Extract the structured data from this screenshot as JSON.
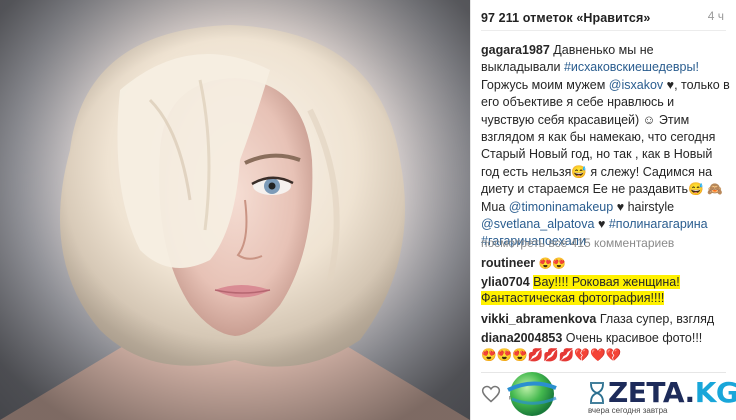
{
  "post": {
    "likes_text": "97 211 отметок «Нравится»",
    "time": "4 ч"
  },
  "caption": {
    "user": "gagara1987",
    "line1": "Давненько мы не выкладывали ",
    "tag1": "#исхаковскиешедевры!",
    "line2": "Горжусь моим мужем ",
    "mention1": "@isxakov",
    "line3": " ♥, только в его объективе я себе нравлюсь и чувствую себя красавицей) ☺ Этим взглядом я как бы намекаю, что сегодня Старый Новый год, но так , как в Новый год есть нельзя😅 я слежу! Садимся на диету и стараемся Ее не раздавить😅 🙈 Mua ",
    "mention2": "@timoninamakeup",
    "line4": " ♥ hairstyle ",
    "mention3": "@svetlana_alpatova",
    "line5": " ♥ ",
    "tag2": "#полинагагарина",
    "tag3": "#гагаринапоехали"
  },
  "comments": {
    "view_all": "посмотреть все 415 комментариев",
    "c1_user": "routineer",
    "c1_text": "😍😍",
    "c2_user": "ylia0704",
    "c2_text": "Вау!!!! Роковая женщина! Фантастическая фотография!!!!",
    "c3_user": "vikki_abramenkova",
    "c3_text": "Глаза супер, взгляд",
    "c4_user": "diana2004853",
    "c4_text": "Очень красивое фото!!!",
    "c5_text": "😍😍😍💋💋💋💔❤️💔"
  },
  "actions": {
    "comment_placeholder": "Д"
  },
  "watermark": {
    "main": "ZETA.",
    "kg": "KG",
    "tagline": "вчера сегодня завтра"
  },
  "colors": {
    "link": "#2a5d8f",
    "highlight": "#fff100"
  }
}
